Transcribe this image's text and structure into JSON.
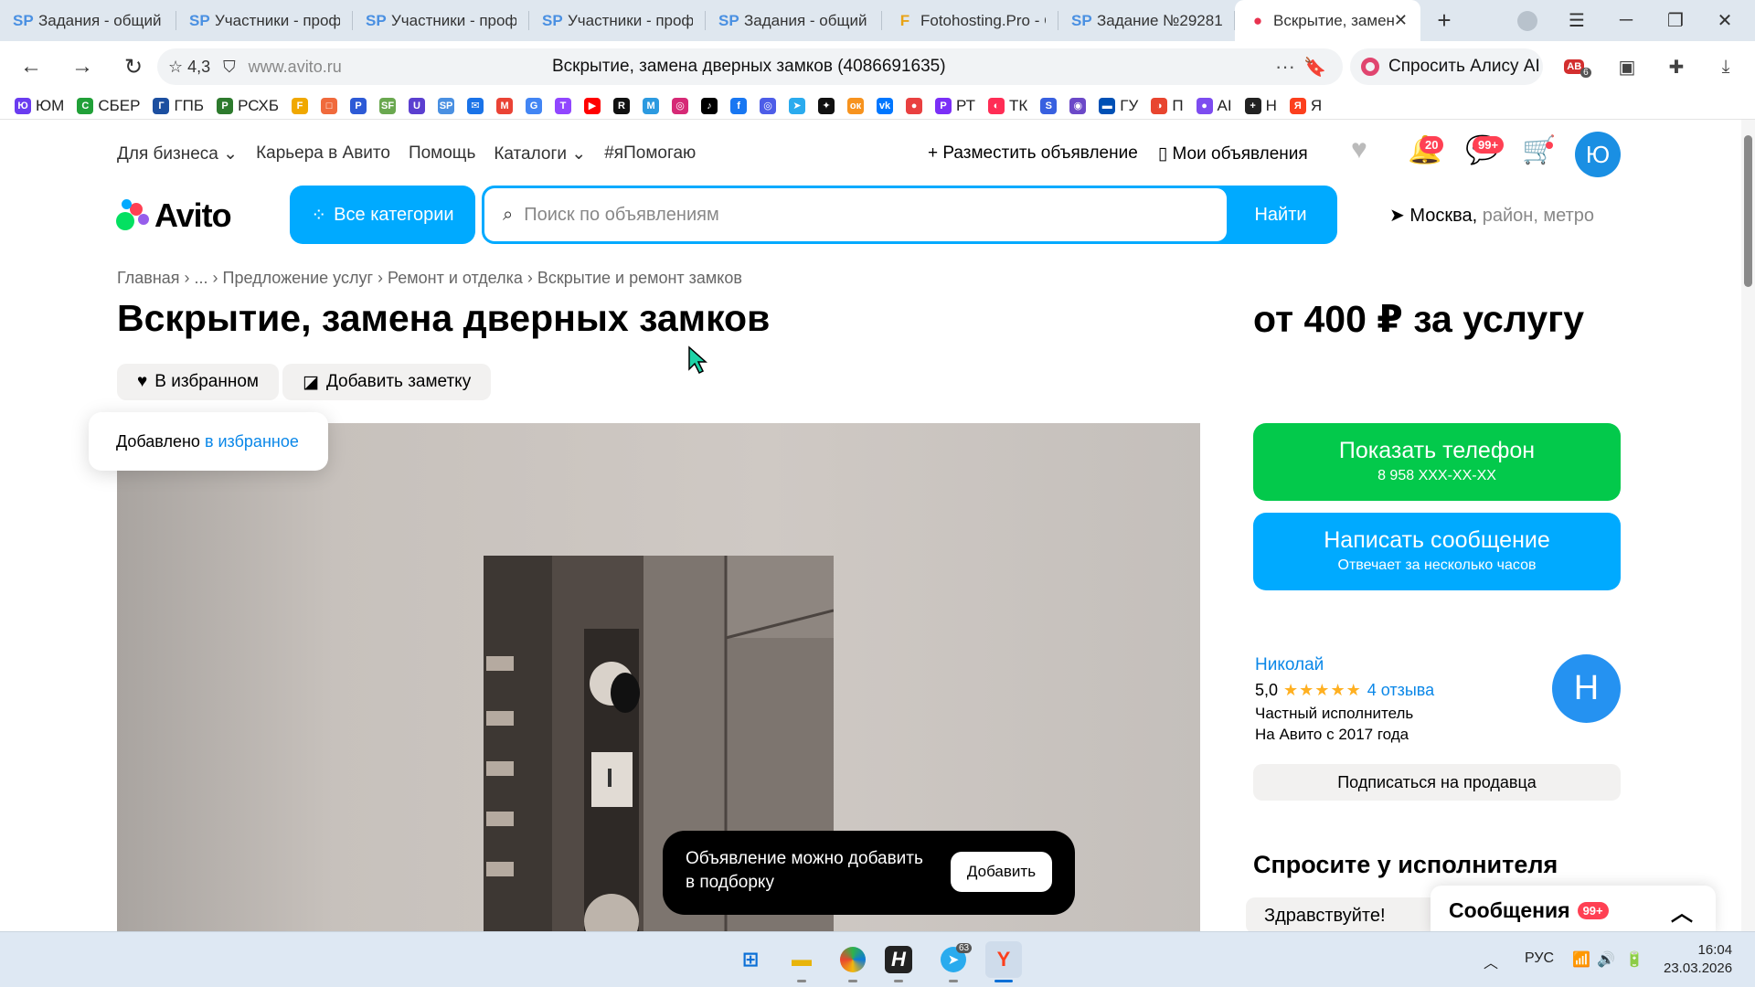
{
  "tabs": [
    {
      "icon": "SP",
      "label": "Задания - общий список"
    },
    {
      "icon": "SP",
      "label": "Участники - профиль"
    },
    {
      "icon": "SP",
      "label": "Участники - профиль"
    },
    {
      "icon": "SP",
      "label": "Участники - профиль"
    },
    {
      "icon": "SP",
      "label": "Задания - общий список"
    },
    {
      "icon": "F",
      "label": "Fotohosting.Pro - Сохранено"
    },
    {
      "icon": "SP",
      "label": "Задание №29281"
    },
    {
      "icon": "●",
      "label": "Вскрытие, замена",
      "active": true
    }
  ],
  "browser": {
    "rating": "4,3",
    "domain": "www.avito.ru",
    "page_title": "Вскрытие, замена дверных замков (4086691635)",
    "alice_label": "Спросить Алису AI",
    "ext_badge": "6"
  },
  "bookmarks": [
    {
      "label": "ЮМ",
      "color": "#6a3cf0",
      "glyph": "Ю"
    },
    {
      "label": "СБЕР",
      "color": "#21a038",
      "glyph": "С"
    },
    {
      "label": "ГПБ",
      "color": "#1c4fa0",
      "glyph": "Г"
    },
    {
      "label": "РСХБ",
      "color": "#2d7a2d",
      "glyph": "Р"
    },
    {
      "label": "",
      "color": "#f0a800",
      "glyph": "F"
    },
    {
      "label": "",
      "color": "#f06a3c",
      "glyph": "□"
    },
    {
      "label": "",
      "color": "#2d5ad6",
      "glyph": "P"
    },
    {
      "label": "",
      "color": "#6aa84f",
      "glyph": "SF"
    },
    {
      "label": "",
      "color": "#5b3fd0",
      "glyph": "U"
    },
    {
      "label": "",
      "color": "#4a90e2",
      "glyph": "SP"
    },
    {
      "label": "",
      "color": "#1a73e8",
      "glyph": "✉"
    },
    {
      "label": "",
      "color": "#ea4335",
      "glyph": "M"
    },
    {
      "label": "",
      "color": "#4285f4",
      "glyph": "G"
    },
    {
      "label": "",
      "color": "#9146ff",
      "glyph": "T"
    },
    {
      "label": "",
      "color": "#ff0000",
      "glyph": "▶"
    },
    {
      "label": "",
      "color": "#111111",
      "glyph": "R"
    },
    {
      "label": "",
      "color": "#2c9ae0",
      "glyph": "M"
    },
    {
      "label": "",
      "color": "#d62976",
      "glyph": "◎"
    },
    {
      "label": "",
      "color": "#000000",
      "glyph": "♪"
    },
    {
      "label": "",
      "color": "#1877f2",
      "glyph": "f"
    },
    {
      "label": "",
      "color": "#4d5de8",
      "glyph": "◎"
    },
    {
      "label": "",
      "color": "#2aabee",
      "glyph": "➤"
    },
    {
      "label": "",
      "color": "#111111",
      "glyph": "✦"
    },
    {
      "label": "",
      "color": "#f7931e",
      "glyph": "ок"
    },
    {
      "label": "",
      "color": "#0077ff",
      "glyph": "vk"
    },
    {
      "label": "",
      "color": "#e94040",
      "glyph": "●"
    },
    {
      "label": "РТ",
      "color": "#7b2ff7",
      "glyph": "P"
    },
    {
      "label": "ТК",
      "color": "#ff2d55",
      "glyph": "◐"
    },
    {
      "label": "",
      "color": "#3860e0",
      "glyph": "S"
    },
    {
      "label": "",
      "color": "#6b48c8",
      "glyph": "◉"
    },
    {
      "label": "ГУ",
      "color": "#0050b5",
      "glyph": "▬"
    },
    {
      "label": "П",
      "color": "#e8452f",
      "glyph": "◑"
    },
    {
      "label": "AI",
      "color": "#7d4cf0",
      "glyph": "●"
    },
    {
      "label": "Н",
      "color": "#222222",
      "glyph": "+"
    },
    {
      "label": "Я",
      "color": "#fc3f1d",
      "glyph": "Я"
    }
  ],
  "site": {
    "nav": [
      "Для бизнеса",
      "Карьера в Авито",
      "Помощь",
      "Каталоги",
      "#яПомогаю"
    ],
    "post_ad": "Разместить объявление",
    "my_ads": "Мои объявления",
    "notif_count": "20",
    "msg_count": "99+",
    "user_initial": "Ю",
    "logo_text": "Avito",
    "all_categories": "Все категории",
    "search_placeholder": "Поиск по объявлениям",
    "search_button": "Найти",
    "location_city": "Москва,",
    "location_rest": "район, метро"
  },
  "listing": {
    "breadcrumbs": [
      "Главная",
      "...",
      "Предложение услуг",
      "Ремонт и отделка",
      "Вскрытие и ремонт замков"
    ],
    "title": "Вскрытие, замена дверных замков",
    "price": "от 400 ₽ за услугу",
    "fav_label": "В избранном",
    "note_label": "Добавить заметку",
    "toast_text": "Добавлено",
    "toast_link": "в избранное",
    "show_phone": "Показать телефон",
    "phone_masked": "8 958 XXX-XX-XX",
    "write_msg": "Написать сообщение",
    "reply_time": "Отвечает за несколько часов",
    "seller_name": "Николай",
    "seller_rating": "5,0",
    "seller_reviews": "4 отзыва",
    "seller_type": "Частный исполнитель",
    "seller_since": "На Авито с 2017 года",
    "seller_initial": "Н",
    "subscribe": "Подписаться на продавца",
    "ask_title": "Спросите у исполнителя",
    "ask_hello": "Здравствуйте!",
    "messages_label": "Сообщения",
    "messages_count": "99+",
    "snack_line1": "Объявление можно добавить",
    "snack_line2": "в подборку",
    "snack_button": "Добавить"
  },
  "taskbar": {
    "lang": "РУС",
    "time": "16:04",
    "date": "23.03.2026",
    "telegram_badge": "63"
  }
}
